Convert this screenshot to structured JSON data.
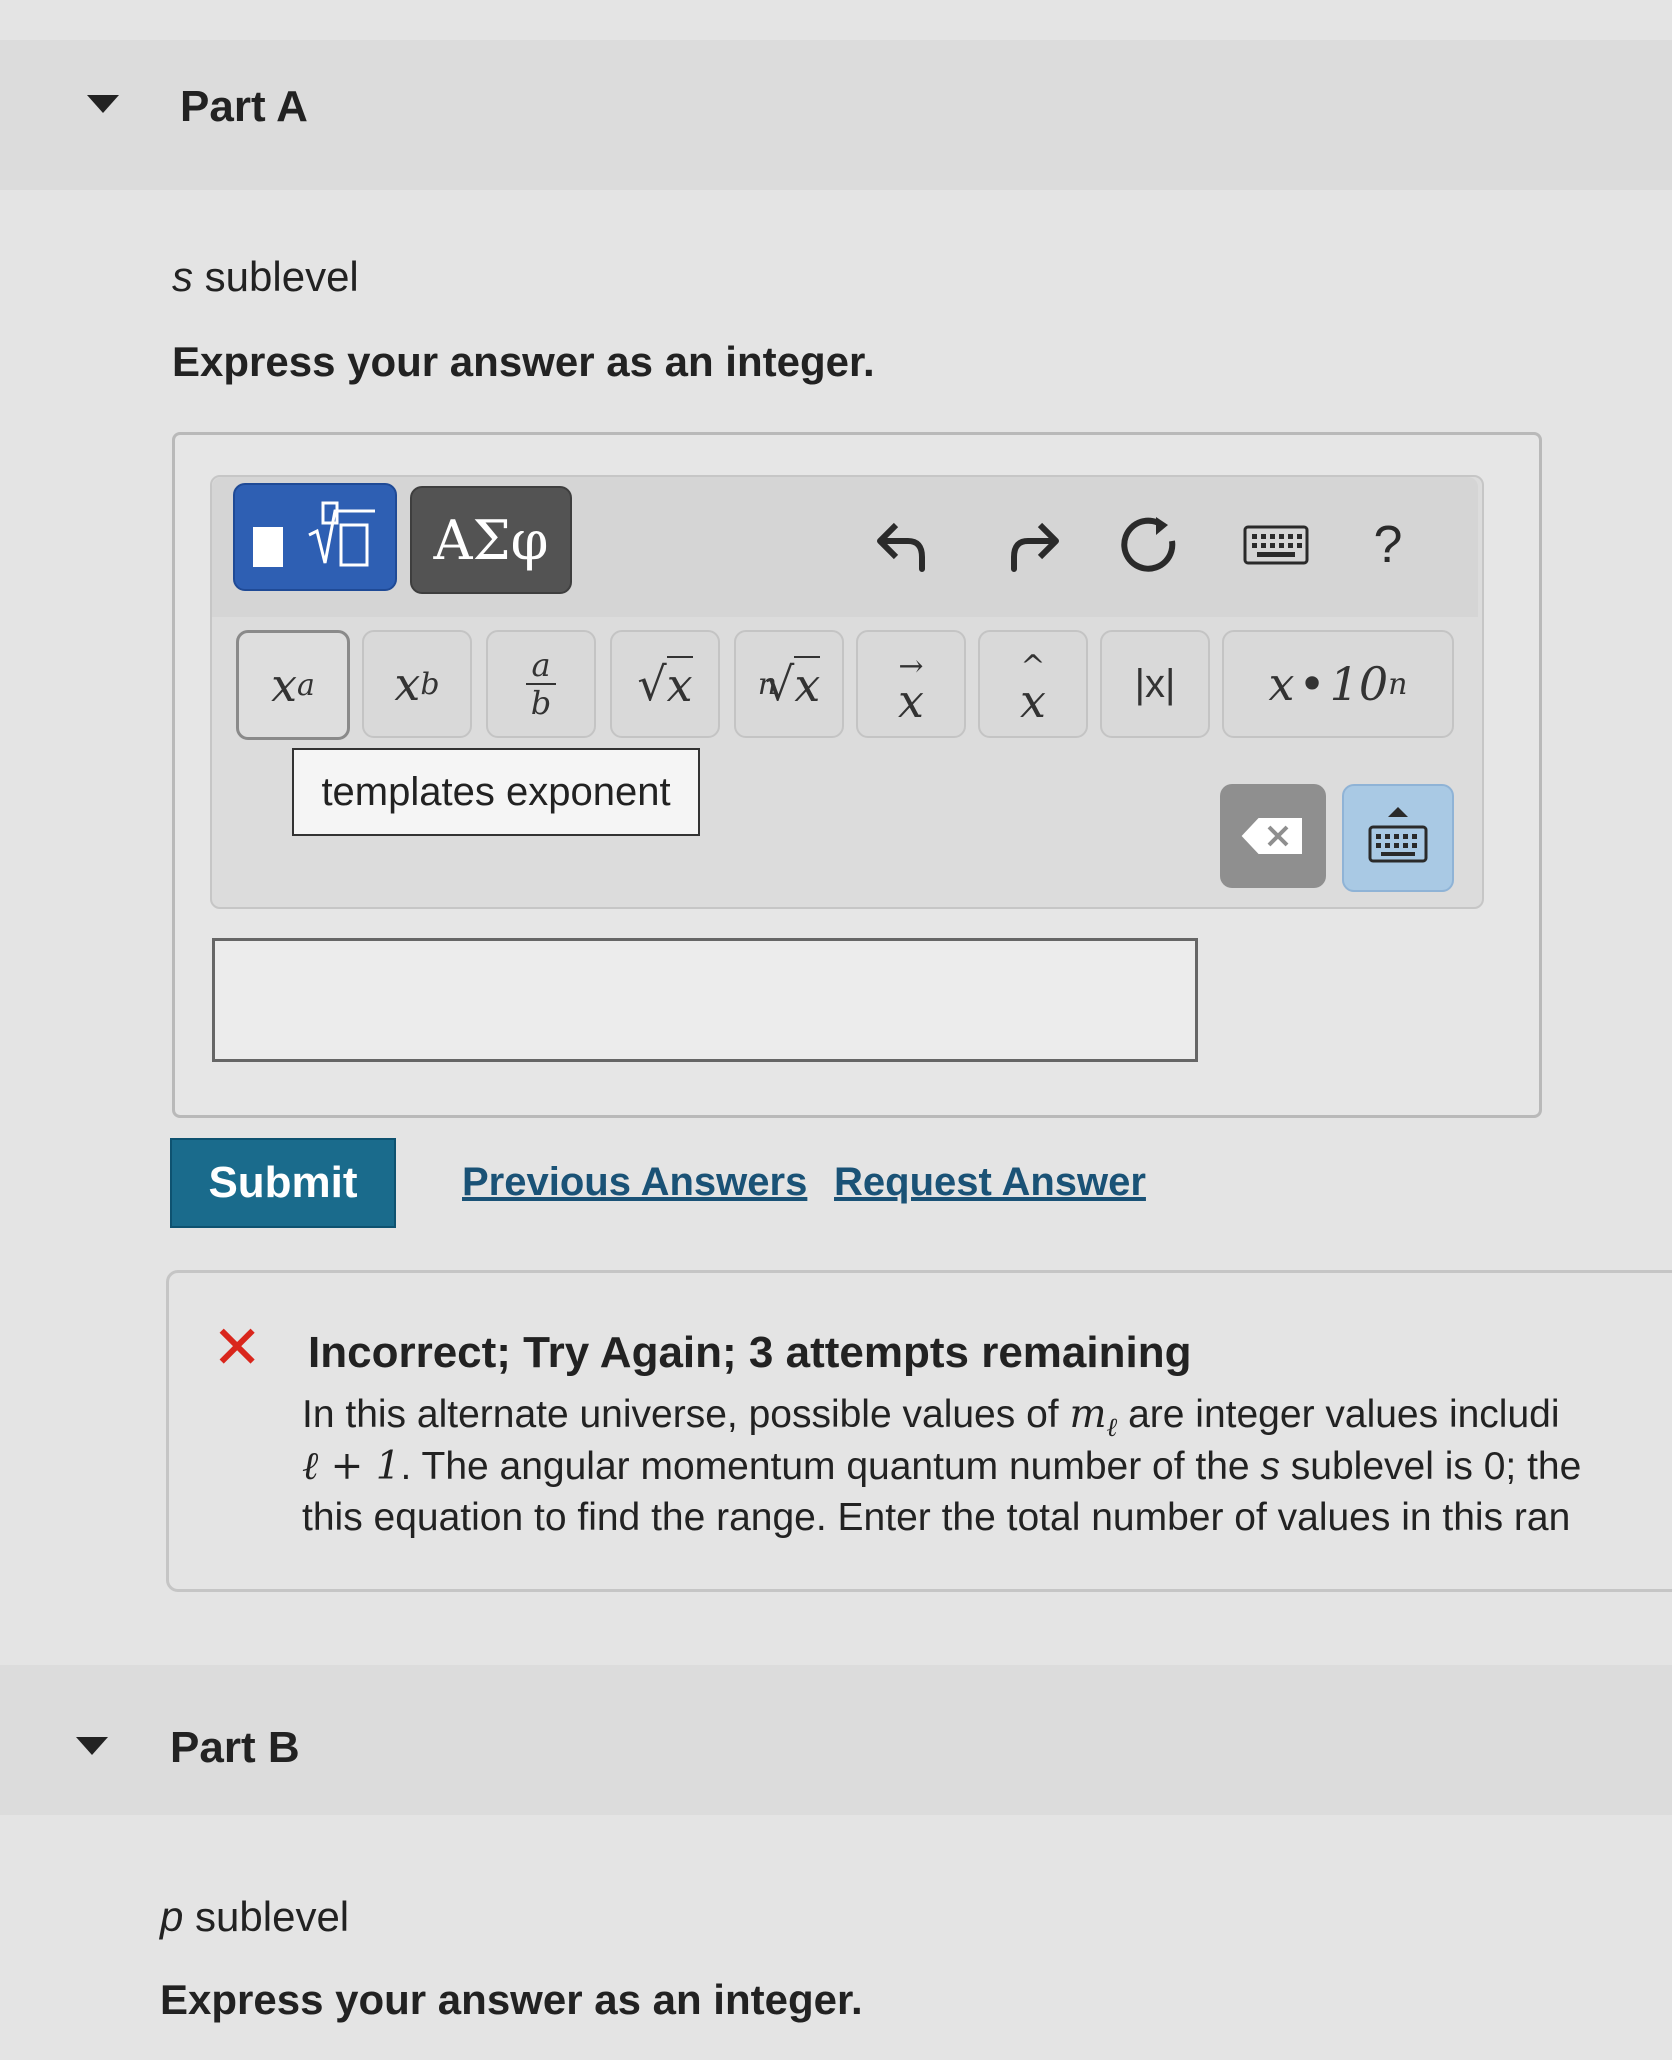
{
  "partA": {
    "title": "Part A",
    "sublevel_letter": "s",
    "sublevel_word": "sublevel",
    "instruction": "Express your answer as an integer."
  },
  "toolbar": {
    "symbols_tab_label": "ΑΣφ",
    "help_label": "?",
    "templates": {
      "exponent_base": "x",
      "exponent_sup": "a",
      "subscript_base": "x",
      "subscript_sub": "b",
      "fraction_num": "a",
      "fraction_den": "b",
      "sqrt_arg": "x",
      "nthroot_index": "n",
      "nthroot_arg": "x",
      "vector_arg": "x",
      "unitvector_arg": "x",
      "abs_label": "|x|",
      "sci_base": "x",
      "sci_dot": "•",
      "sci_ten": "10",
      "sci_exp": "n"
    },
    "tooltip": "templates exponent"
  },
  "answer_input": {
    "value": ""
  },
  "actions": {
    "submit_label": "Submit",
    "previous_answers_label": "Previous Answers",
    "request_answer_label": "Request Answer"
  },
  "feedback": {
    "icon": "x-mark-icon",
    "title": "Incorrect; Try Again; 3 attempts remaining",
    "line1_a": "In this alternate universe, possible values of ",
    "line1_sym": "m",
    "line1_sym_sub": "ℓ",
    "line1_b": " are integer values includi",
    "line2_sym": "ℓ + 1",
    "line2_b": ". The angular momentum quantum number of the ",
    "line2_s": "s",
    "line2_c": " sublevel is 0; the",
    "line3": "this equation to find the range. Enter the total number of values in this ran",
    "color": "#d9261c"
  },
  "partB": {
    "title": "Part B",
    "sublevel_letter": "p",
    "sublevel_word": "sublevel",
    "instruction": "Express your answer as an integer."
  },
  "colors": {
    "templates_tab": "#2e5fb3",
    "symbols_tab": "#535353",
    "submit": "#1a6b8c",
    "link": "#1a5276",
    "keyboard_toggle": "#a9c9e4"
  }
}
